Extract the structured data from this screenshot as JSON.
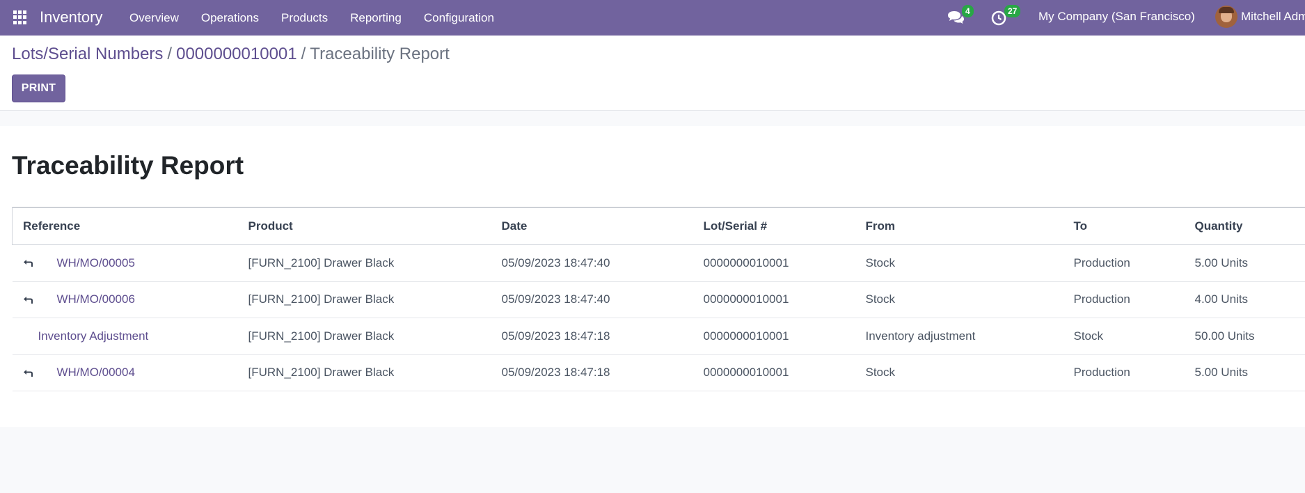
{
  "navbar": {
    "app_name": "Inventory",
    "menu": [
      "Overview",
      "Operations",
      "Products",
      "Reporting",
      "Configuration"
    ],
    "messages_count": "4",
    "activities_count": "27",
    "company": "My Company (San Francisco)",
    "user": "Mitchell Admin",
    "color": "#71639e"
  },
  "breadcrumb": {
    "items": [
      "Lots/Serial Numbers",
      "0000000010001"
    ],
    "active": "Traceability Report"
  },
  "actions": {
    "print_label": "PRINT"
  },
  "report": {
    "title": "Traceability Report",
    "columns": [
      "Reference",
      "Product",
      "Date",
      "Lot/Serial #",
      "From",
      "To",
      "Quantity"
    ],
    "rows": [
      {
        "has_arrow": true,
        "reference": "WH/MO/00005",
        "product": "[FURN_2100] Drawer Black",
        "date": "05/09/2023 18:47:40",
        "lot": "0000000010001",
        "from": "Stock",
        "to": "Production",
        "quantity": "5.00 Units"
      },
      {
        "has_arrow": true,
        "reference": "WH/MO/00006",
        "product": "[FURN_2100] Drawer Black",
        "date": "05/09/2023 18:47:40",
        "lot": "0000000010001",
        "from": "Stock",
        "to": "Production",
        "quantity": "4.00 Units"
      },
      {
        "has_arrow": false,
        "reference": "Inventory Adjustment",
        "product": "[FURN_2100] Drawer Black",
        "date": "05/09/2023 18:47:18",
        "lot": "0000000010001",
        "from": "Inventory adjustment",
        "to": "Stock",
        "quantity": "50.00 Units"
      },
      {
        "has_arrow": true,
        "reference": "WH/MO/00004",
        "product": "[FURN_2100] Drawer Black",
        "date": "05/09/2023 18:47:18",
        "lot": "0000000010001",
        "from": "Stock",
        "to": "Production",
        "quantity": "5.00 Units"
      }
    ]
  }
}
